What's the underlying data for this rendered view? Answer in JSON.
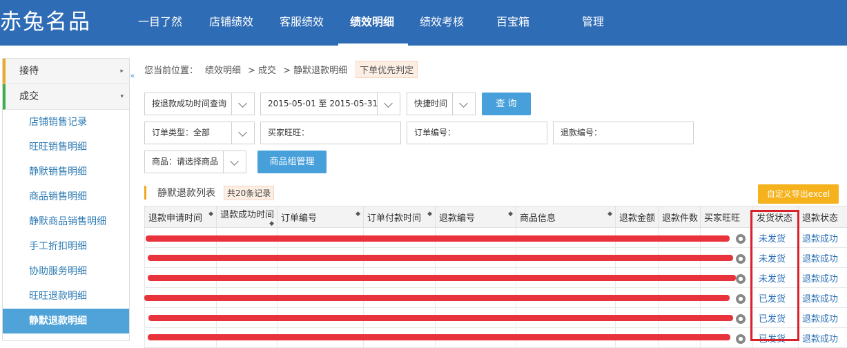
{
  "header": {
    "logo": "赤兔名品",
    "nav": [
      {
        "label": "一目了然",
        "active": false
      },
      {
        "label": "店铺绩效",
        "active": false
      },
      {
        "label": "客服绩效",
        "active": false
      },
      {
        "label": "绩效明细",
        "active": true
      },
      {
        "label": "绩效考核",
        "active": false
      },
      {
        "label": "百宝箱",
        "active": false
      },
      {
        "label": "管理",
        "active": false
      }
    ]
  },
  "sidebar": {
    "groups": [
      {
        "label": "接待",
        "arrow": "▸"
      },
      {
        "label": "成交",
        "arrow": "▾"
      }
    ],
    "items": [
      {
        "label": "店铺销售记录",
        "active": false
      },
      {
        "label": "旺旺销售明细",
        "active": false
      },
      {
        "label": "静默销售明细",
        "active": false
      },
      {
        "label": "商品销售明细",
        "active": false
      },
      {
        "label": "静默商品销售明细",
        "active": false
      },
      {
        "label": "手工折扣明细",
        "active": false
      },
      {
        "label": "协助服务明细",
        "active": false
      },
      {
        "label": "旺旺退款明细",
        "active": false
      },
      {
        "label": "静默退款明细",
        "active": true
      }
    ],
    "collapse_glyph": "«"
  },
  "breadcrumb": {
    "prefix": "您当前位置：",
    "level1": "绩效明细",
    "level2": "> 成交",
    "level3": "> 静默退款明细",
    "tag": "下单优先判定"
  },
  "filters": {
    "query_mode": "按退款成功时间查询",
    "date_range": "2015-05-01 至 2015-05-31",
    "quick_time": "快捷时间",
    "query_button": "查 询",
    "order_type": "订单类型：全部",
    "buyer_label": "买家旺旺：",
    "order_no_label": "订单编号：",
    "refund_no_label": "退款编号：",
    "product": "商品：请选择商品",
    "group_button": "商品组管理"
  },
  "list": {
    "title": "静默退款列表",
    "count": "共20条记录",
    "export_button": "自定义导出excel"
  },
  "table": {
    "columns": [
      "退款申请时间",
      "退款成功时间",
      "订单编号",
      "订单付款时间",
      "退款编号",
      "商品信息",
      "退款金额",
      "退款件数",
      "买家旺旺",
      "发货状态",
      "退款状态"
    ],
    "rows": [
      {
        "ship": "未发货",
        "refund": "退款成功"
      },
      {
        "ship": "未发货",
        "refund": "退款成功"
      },
      {
        "ship": "未发货",
        "refund": "退款成功"
      },
      {
        "ship": "已发货",
        "refund": "退款成功"
      },
      {
        "ship": "已发货",
        "refund": "退款成功"
      },
      {
        "ship": "已发货",
        "refund": "退款成功"
      }
    ]
  },
  "colors": {
    "brand": "#2f6cb6",
    "accent_blue": "#48a0db",
    "export_orange": "#f5b21c",
    "redact_red": "#e8323c"
  }
}
